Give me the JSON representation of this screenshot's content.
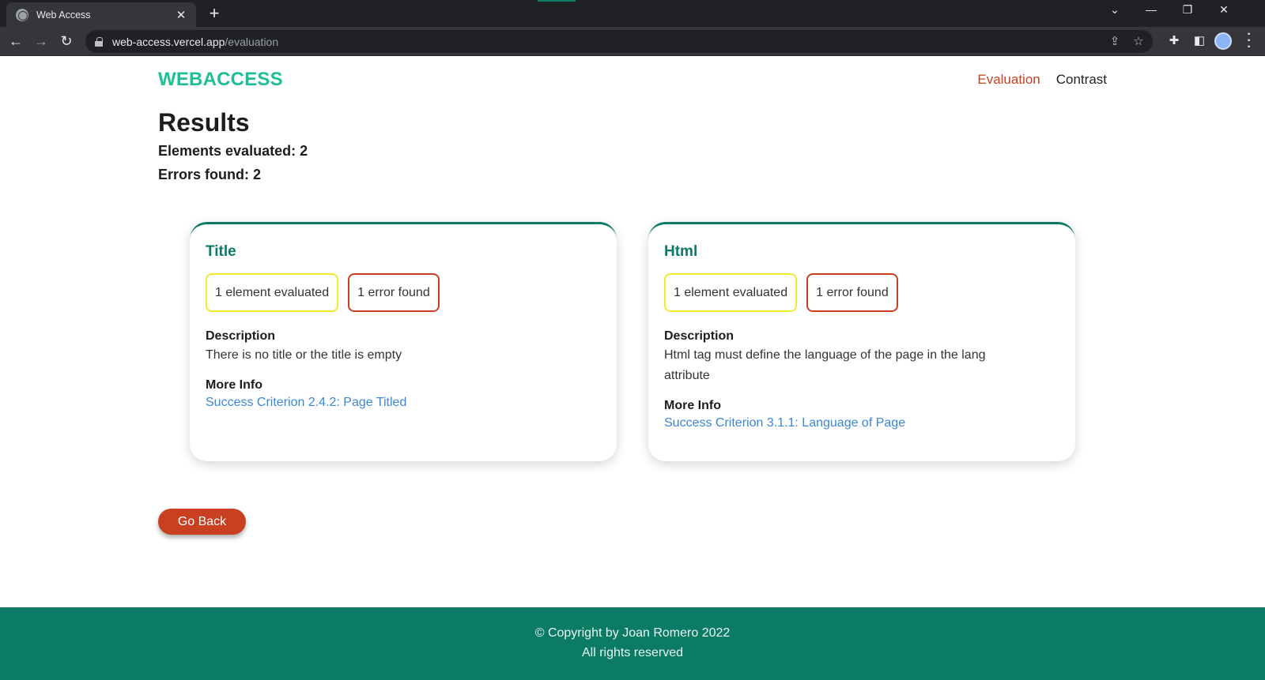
{
  "browser": {
    "tab_title": "Web Access",
    "tab_close": "✕",
    "new_tab": "+",
    "url_host": "web-access.vercel.app",
    "url_path": "/evaluation"
  },
  "site": {
    "brand": "WEBACCESS",
    "nav": [
      {
        "label": "Evaluation"
      },
      {
        "label": "Contrast"
      }
    ]
  },
  "results": {
    "title": "Results",
    "elements_evaluated": "Elements evaluated: 2",
    "errors_found": "Errors found: 2"
  },
  "cards": [
    {
      "title": "Title",
      "evaluated_badge": "1 element evaluated",
      "error_badge": "1 error found",
      "description_label": "Description",
      "description": "There is no title or the title is empty",
      "more_info_label": "More Info",
      "link_text": "Success Criterion 2.4.2: Page Titled"
    },
    {
      "title": "Html",
      "evaluated_badge": "1 element evaluated",
      "error_badge": "1 error found",
      "description_label": "Description",
      "description": "Html tag must define the language of the page in the lang attribute",
      "more_info_label": "More Info",
      "link_text": "Success Criterion 3.1.1: Language of Page"
    }
  ],
  "go_back": "Go Back",
  "footer": {
    "copyright": "© Copyright by Joan Romero 2022",
    "rights": "All rights reserved"
  },
  "colors": {
    "brand": "#1fbf95",
    "primary": "#0b7b66",
    "accent": "#c8401f",
    "warning": "#f2ec2d",
    "link": "#3a87d6"
  }
}
